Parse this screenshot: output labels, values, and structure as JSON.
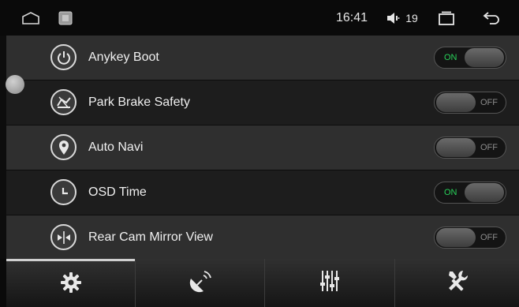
{
  "status_bar": {
    "time": "16:41",
    "volume": "19",
    "icons": [
      "home-icon",
      "app-thumbnail-icon",
      "volume-icon",
      "recent-apps-icon",
      "back-icon"
    ]
  },
  "settings": [
    {
      "label": "Anykey Boot",
      "icon": "power-icon",
      "state": "ON"
    },
    {
      "label": "Park Brake Safety",
      "icon": "park-brake-icon",
      "state": "OFF"
    },
    {
      "label": "Auto Navi",
      "icon": "location-pin-icon",
      "state": "OFF"
    },
    {
      "label": "OSD Time",
      "icon": "clock-icon",
      "state": "ON"
    },
    {
      "label": "Rear Cam Mirror View",
      "icon": "mirror-flip-icon",
      "state": "OFF"
    }
  ],
  "tabs": [
    {
      "icon": "gear-icon",
      "active": true
    },
    {
      "icon": "satellite-dish-icon",
      "active": false
    },
    {
      "icon": "equalizer-icon",
      "active": false
    },
    {
      "icon": "tools-icon",
      "active": false
    }
  ],
  "colors": {
    "toggle_on_text": "#28d25a",
    "toggle_off_text": "#8c8c8c"
  }
}
